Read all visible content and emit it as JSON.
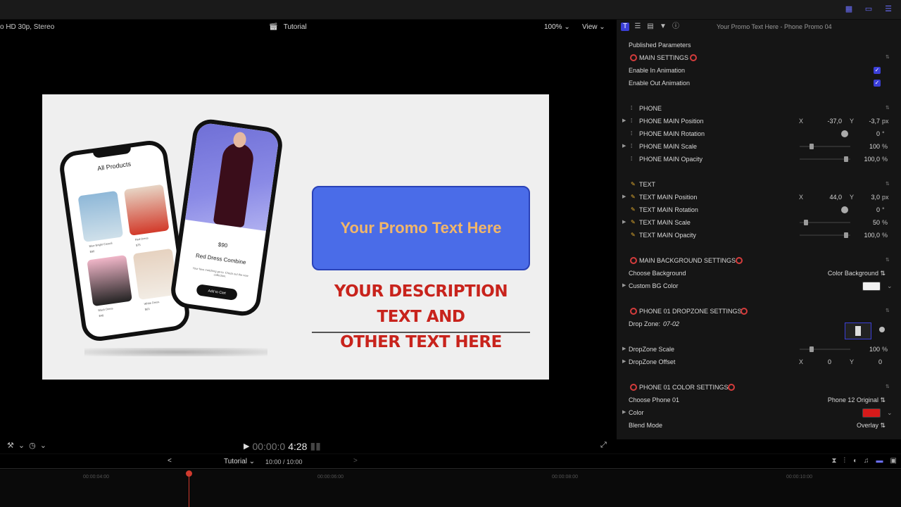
{
  "viewer": {
    "format": "o HD 30p, Stereo",
    "project": "Tutorial",
    "zoom": "100%",
    "view": "View"
  },
  "canvas": {
    "phone_back_title": "All Products",
    "thumb_caps": [
      "Blue Bright Casual",
      "Red Dress",
      "Black Dress",
      "White Dress"
    ],
    "thumb_prices": [
      "$90",
      "$75",
      "$48",
      "$63"
    ],
    "product_price": "$90",
    "product_name": "Red Dress Combine",
    "product_desc": "Your fave matching go-to. Check out the new collection.",
    "cart_button": "Add to Cart",
    "promo_text": "Your Promo Text Here",
    "description_line1": "YOUR DESCRIPTION TEXT AND",
    "description_line2": "OTHER TEXT HERE",
    "promo_color": "#4a6ce8",
    "promo_text_color": "#f1b66a",
    "description_color": "#c8231c"
  },
  "transport": {
    "timecode_dim": "00:00:0",
    "timecode_bright": "4:28"
  },
  "inspector": {
    "title": "Your Promo Text Here - Phone Promo 04",
    "published": "Published Parameters",
    "main_settings": "MAIN SETTINGS",
    "enable_in": "Enable In Animation",
    "enable_out": "Enable Out Animation",
    "phone_group": "PHONE",
    "phone_pos": "PHONE MAIN Position",
    "phone_pos_x": "-37,0",
    "phone_pos_y": "-3,7",
    "phone_rot": "PHONE MAIN Rotation",
    "phone_rot_val": "0",
    "phone_scale": "PHONE MAIN Scale",
    "phone_scale_val": "100",
    "phone_opacity": "PHONE MAIN Opacity",
    "phone_opacity_val": "100,0",
    "text_group": "TEXT",
    "text_pos": "TEXT MAIN Position",
    "text_pos_x": "44,0",
    "text_pos_y": "3,0",
    "text_rot": "TEXT MAIN Rotation",
    "text_rot_val": "0",
    "text_scale": "TEXT MAIN Scale",
    "text_scale_val": "50",
    "text_opacity": "TEXT MAIN Opacity",
    "text_opacity_val": "100,0",
    "bg_settings": "MAIN BACKGROUND SETTINGS",
    "choose_bg": "Choose Background",
    "choose_bg_val": "Color Background",
    "custom_bg": "Custom BG Color",
    "dz_settings": "PHONE 01 DROPZONE SETTINGS",
    "drop_zone": "Drop Zone:",
    "drop_zone_val": "07-02",
    "dz_scale": "DropZone Scale",
    "dz_scale_val": "100",
    "dz_offset": "DropZone Offset",
    "dz_offset_x": "0",
    "dz_offset_y": "0",
    "color_settings": "PHONE 01 COLOR SETTINGS",
    "choose_phone": "Choose Phone 01",
    "choose_phone_val": "Phone 12 Original",
    "color": "Color",
    "blend": "Blend Mode",
    "blend_val": "Overlay",
    "unit_px": "px",
    "unit_deg": "°",
    "unit_pct": "%",
    "axis_x": "X",
    "axis_y": "Y",
    "custom_bg_color": "#f2f2f2",
    "color_swatch": "#d61a1a"
  },
  "timeline": {
    "project": "Tutorial",
    "duration": "10:00 / 10:00",
    "marks": [
      "00:00:04:00",
      "00:00:06:00",
      "00:00:08:00",
      "00:00:10:00"
    ]
  }
}
